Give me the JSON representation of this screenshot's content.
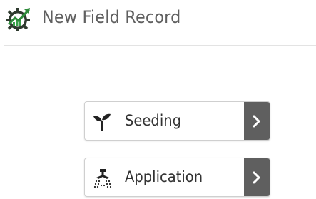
{
  "header": {
    "title": "New Field Record",
    "logo_icon": "gear-growth-chart-logo"
  },
  "options": [
    {
      "label": "Seeding",
      "icon": "seedling-icon",
      "arrow_icon": "chevron-right-icon"
    },
    {
      "label": "Application",
      "icon": "sprayer-icon",
      "arrow_icon": "chevron-right-icon"
    }
  ],
  "colors": {
    "title_text": "#5f5f5f",
    "label_text": "#333333",
    "arrow_button_bg": "#5f5f5f",
    "logo_green": "#2e8b3a",
    "logo_dark": "#2f3b2f"
  }
}
